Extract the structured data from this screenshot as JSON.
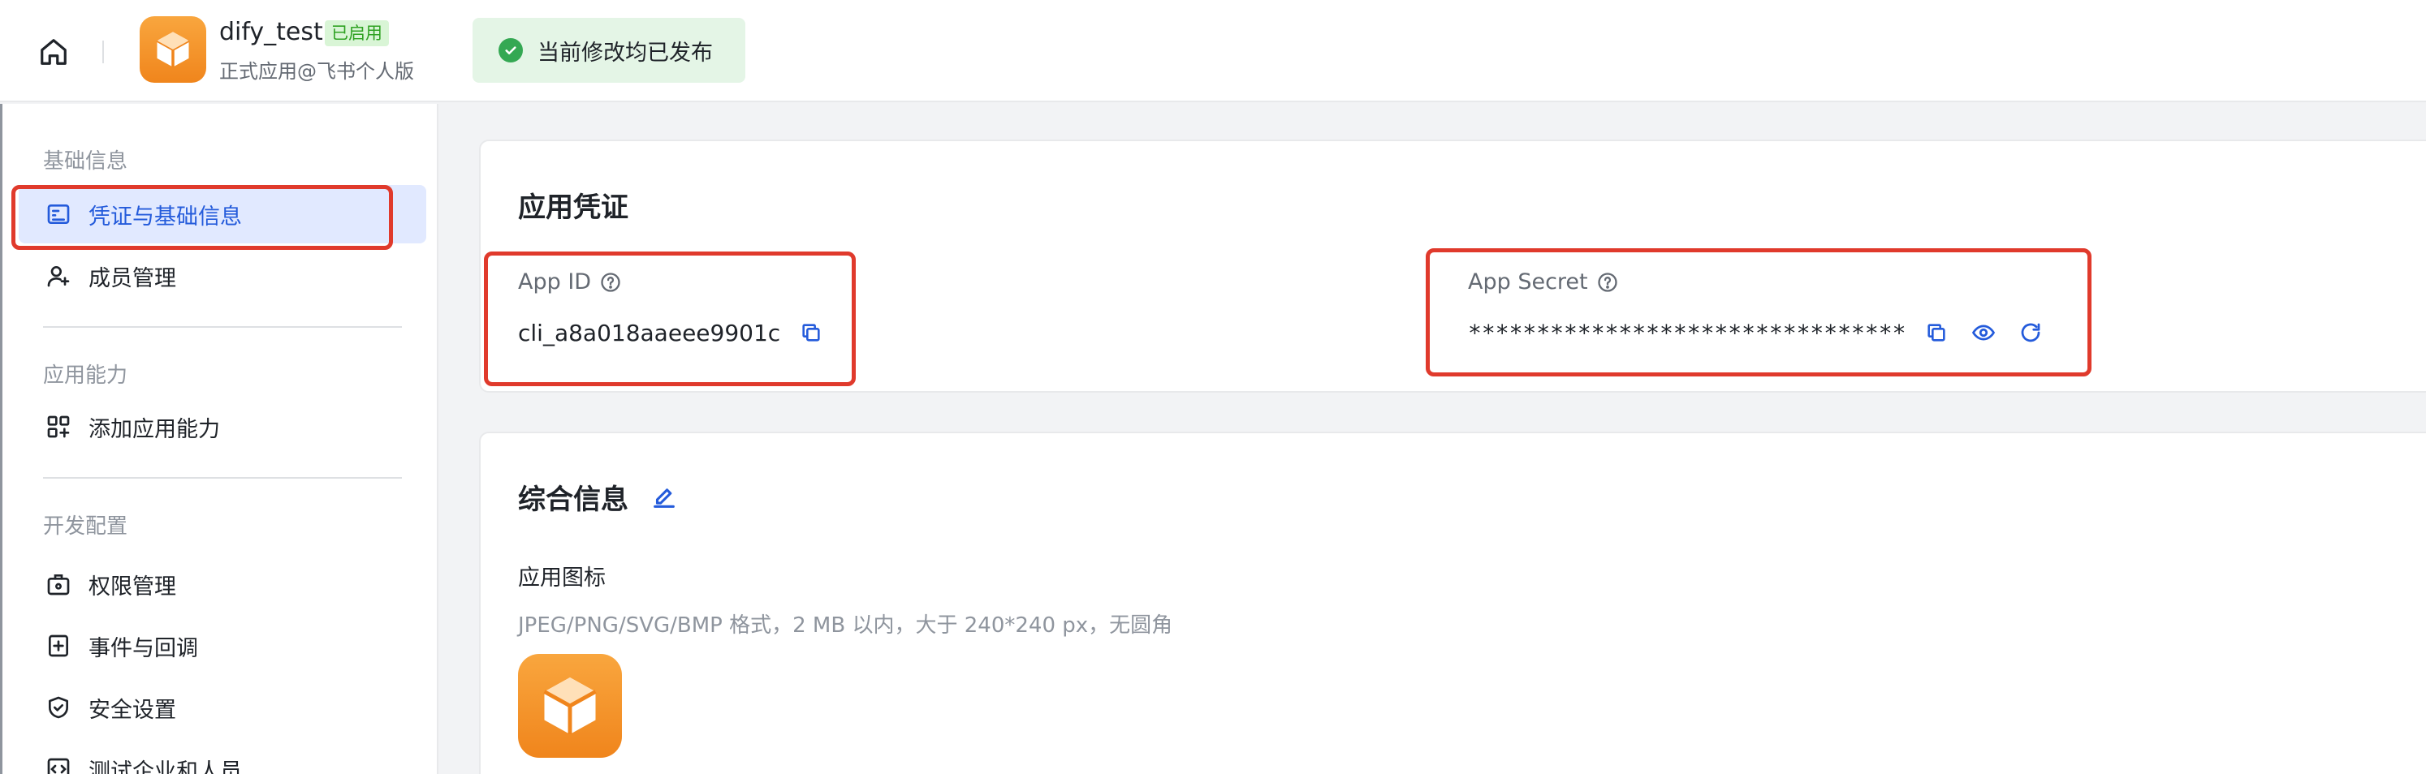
{
  "header": {
    "app_name": "dify_test",
    "status_tag": "已启用",
    "app_subtitle": "正式应用@飞书个人版",
    "publish_status": "当前修改均已发布"
  },
  "sidebar": {
    "groups": [
      {
        "title": "基础信息",
        "items": [
          {
            "label": "凭证与基础信息",
            "icon": "credential-icon",
            "active": true
          },
          {
            "label": "成员管理",
            "icon": "member-icon"
          }
        ]
      },
      {
        "title": "应用能力",
        "items": [
          {
            "label": "添加应用能力",
            "icon": "add-capability-icon"
          }
        ]
      },
      {
        "title": "开发配置",
        "items": [
          {
            "label": "权限管理",
            "icon": "permission-icon"
          },
          {
            "label": "事件与回调",
            "icon": "event-icon"
          },
          {
            "label": "安全设置",
            "icon": "shield-icon"
          },
          {
            "label": "测试企业和人员",
            "icon": "test-icon"
          }
        ]
      }
    ]
  },
  "credentials": {
    "title": "应用凭证",
    "app_id_label": "App ID",
    "app_id_value": "cli_a8a018aaeee9901c",
    "app_secret_label": "App Secret",
    "app_secret_value": "********************************"
  },
  "general_info": {
    "title": "综合信息",
    "icon_label": "应用图标",
    "icon_hint": "JPEG/PNG/SVG/BMP 格式，2 MB 以内，大于 240*240 px，无圆角"
  },
  "colors": {
    "accent": "#245bdb",
    "highlight": "#e03a2c",
    "success": "#34a853",
    "brand_orange": "#f0851c"
  }
}
